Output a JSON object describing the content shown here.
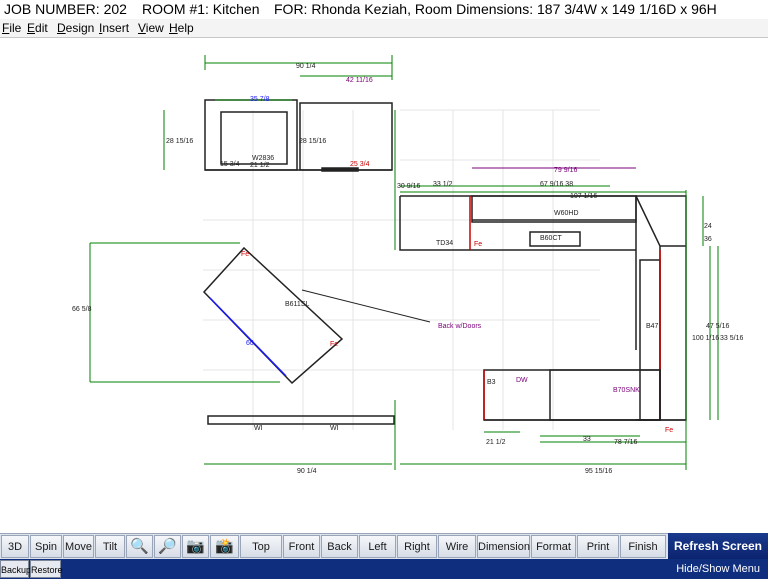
{
  "title": {
    "job": "JOB NUMBER: 202",
    "room": "ROOM #1: Kitchen",
    "for": "FOR:  Rhonda Keziah,  Room Dimensions: 187 3/4W x 149 1/16D x 96H"
  },
  "menu": [
    "File",
    "Edit",
    "Design",
    "Insert",
    "View",
    "Help"
  ],
  "drawing": {
    "dims": {
      "top_width": "90 1/4",
      "top_right_seg": "42 11/16",
      "top_left_seg": "35 7/8",
      "left_height": "28 15/16",
      "mid_height": "28 15/16",
      "small_a": "15 3/4",
      "small_b": "21 1/2",
      "small_c": "25 3/4",
      "hood_dim": "79 9/16",
      "top_run_a": "33 1/2",
      "top_run_b": "67 9/16 38",
      "top_run_c": "107 1/16",
      "left_small": "30 9/16",
      "island_height": "66 5/8",
      "island_diag": "60",
      "right_a": "24",
      "right_b": "36",
      "right_c": "100 1/16",
      "right_d": "47 5/16",
      "right_e": "33 5/16",
      "bottom_a": "21 1/2",
      "bottom_b": "33",
      "bottom_c": "78 7/16",
      "bottom_width": "90 1/4",
      "bottom_right": "95 15/16"
    },
    "labels": {
      "w60hd": "W60HD",
      "b60ct": "B60CT",
      "td34": "TD34",
      "b47": "B47",
      "island": "B611SL",
      "back_doors": "Back w/Doors",
      "dw": "DW",
      "b70snk": "B70SNK",
      "b3": "B3",
      "fe1": "Fe",
      "fe2": "Fe",
      "fe3": "Fe",
      "fe4": "Fe",
      "wi1": "WI",
      "wi2": "WI",
      "window": "W2836"
    }
  },
  "toolbar": {
    "buttons": [
      "3D",
      "Spin",
      "Move",
      "Tilt",
      "Top",
      "Front",
      "Back",
      "Left",
      "Right",
      "Wire",
      "Dimension",
      "Format",
      "Print",
      "Finish"
    ],
    "refresh": "Refresh Screen"
  },
  "bottom": {
    "backup": "Backup",
    "restore": "Restore",
    "hide_show": "Hide/Show Menu"
  },
  "colors": {
    "dimension_line": "#008000",
    "dimension_violet": "#7a007a",
    "dimension_blue": "#1a1aff",
    "cabinet_outline": "#222222",
    "brand_blue": "#0f2e7e"
  }
}
